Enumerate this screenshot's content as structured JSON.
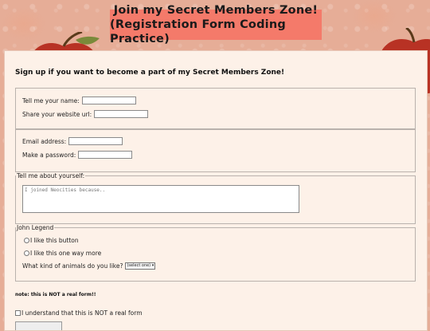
{
  "banner": {
    "line1": "Join my Secret Members Zone!",
    "line2": "(Registration Form Coding Practice)"
  },
  "form": {
    "intro": "Sign up if you want to become a part of my Secret Members Zone!",
    "name_label": "Tell me your name:",
    "name_value": "",
    "website_label": "Share your website url:",
    "website_value": "",
    "email_label": "Email address:",
    "email_value": "",
    "password_label": "Make a password:",
    "password_value": "",
    "about_legend": "Tell me about yourself:",
    "about_placeholder": "I joined Neocities because..",
    "john_legend": "John Legend",
    "radio1_label": "I like this button",
    "radio2_label": "I like this one way more",
    "animals_label": "What kind of animals do you like?",
    "animals_selected": "(select one)",
    "note": "note: this is NOT a real form!!",
    "checkbox_label": "I understand that this is NOT a real form"
  },
  "icons": {
    "select_arrow": "chevron-down-icon"
  },
  "colors": {
    "background": "#e6ad97",
    "banner": "#f47a6a",
    "card": "#fdf1e8"
  }
}
